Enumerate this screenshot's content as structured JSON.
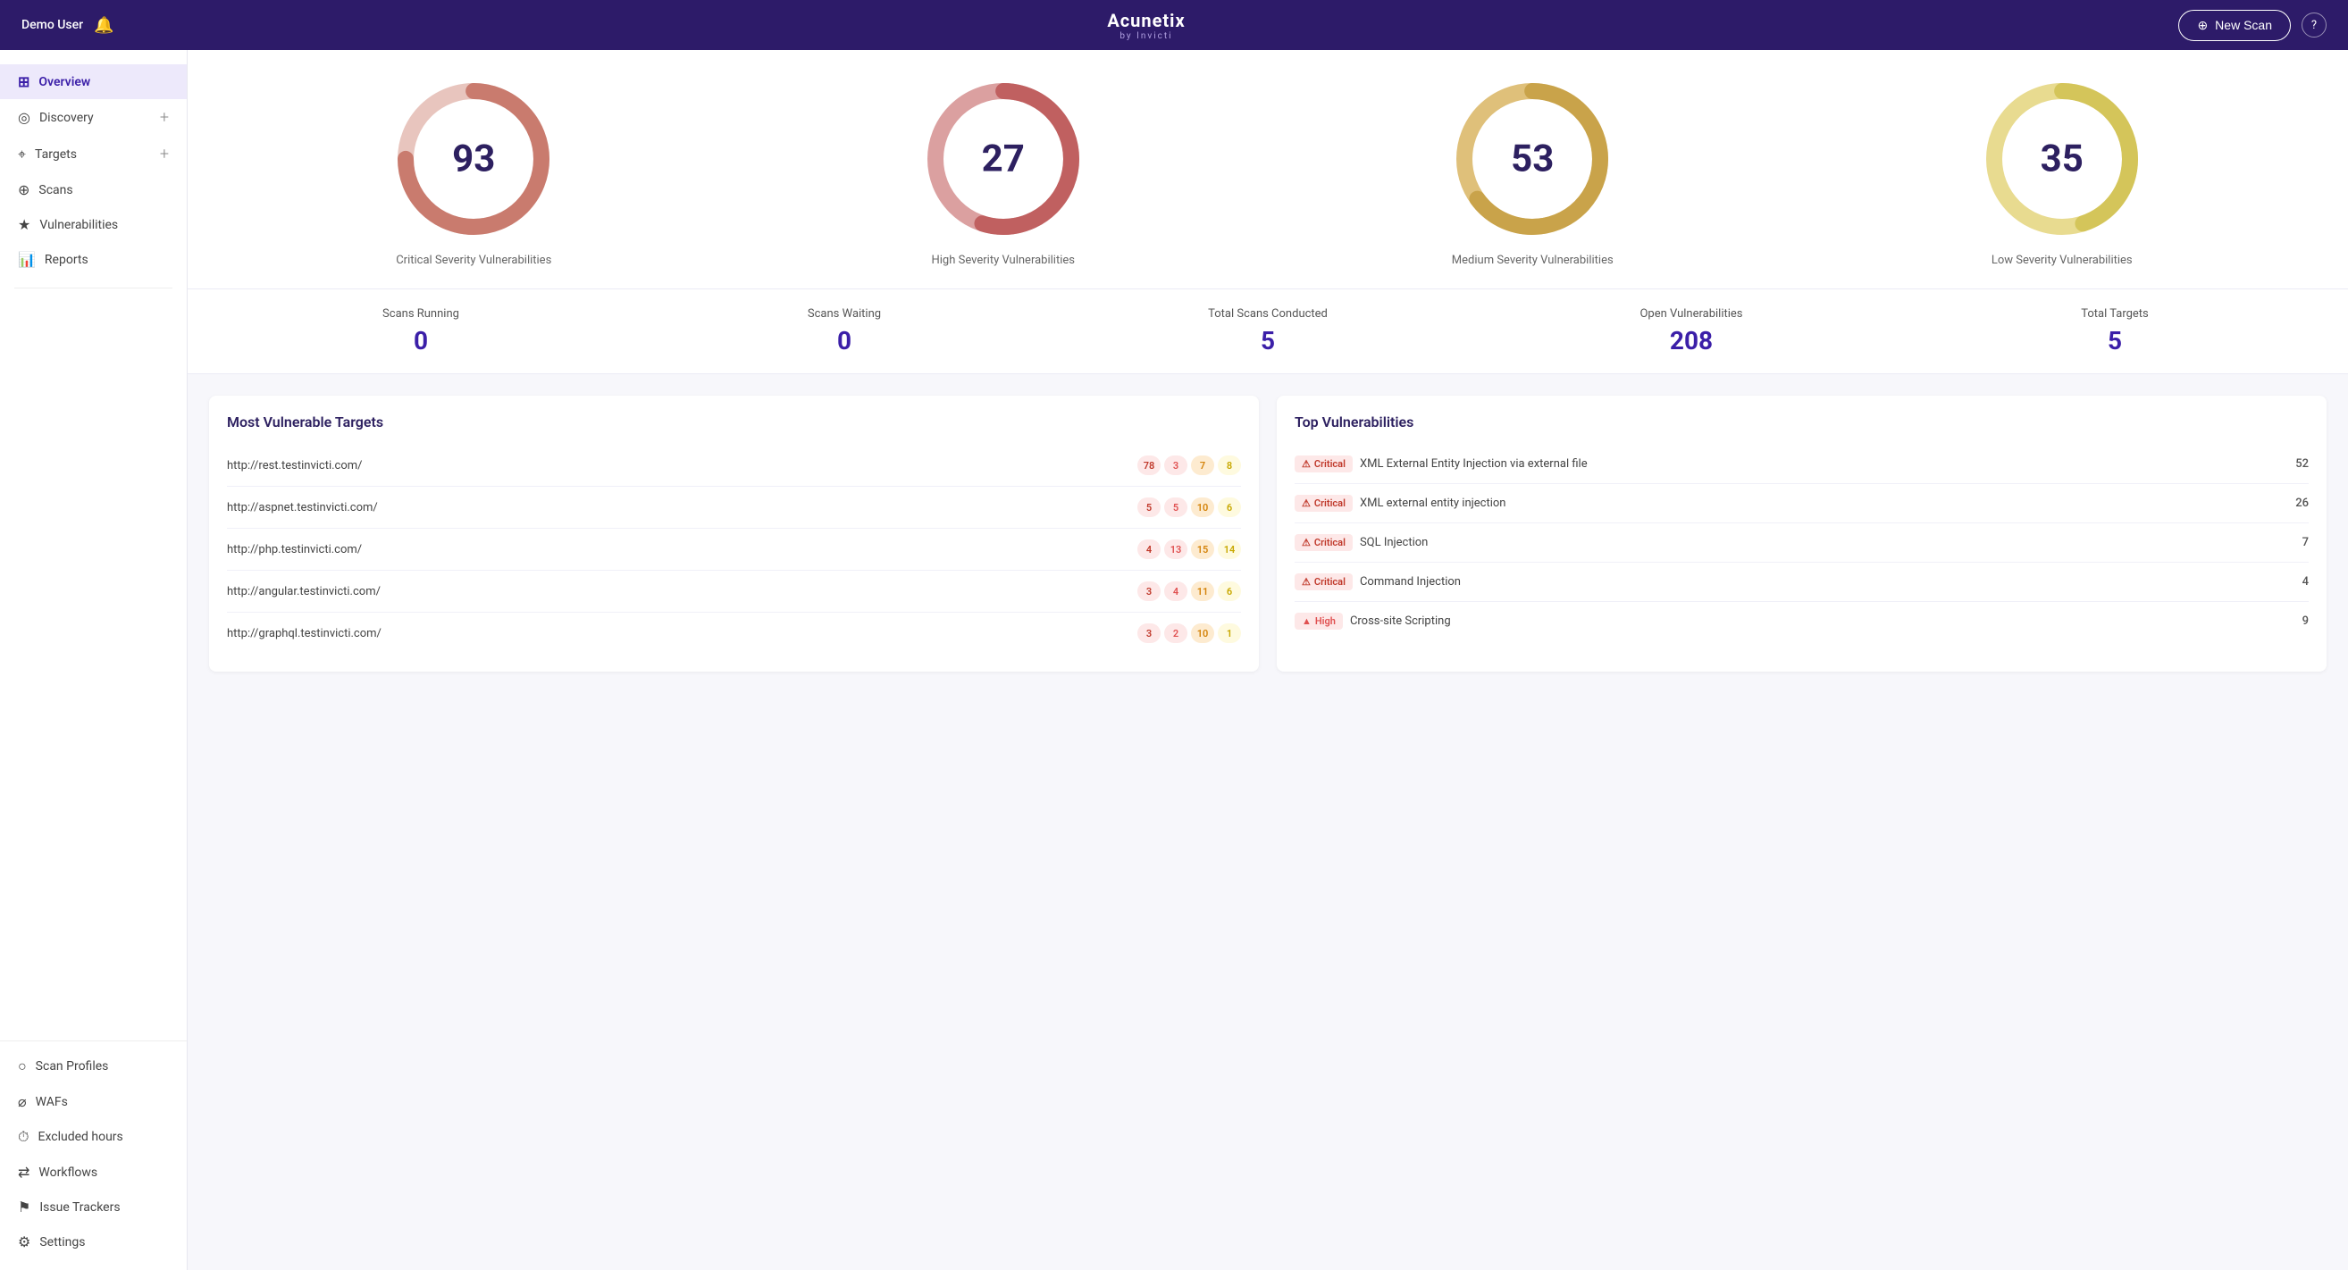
{
  "header": {
    "user": "Demo User",
    "logo": "Acunetix",
    "logo_sub": "by Invicti",
    "new_scan_label": "New Scan",
    "help_icon": "?"
  },
  "sidebar": {
    "main_items": [
      {
        "id": "overview",
        "label": "Overview",
        "icon": "⊞",
        "active": true,
        "has_add": false
      },
      {
        "id": "discovery",
        "label": "Discovery",
        "icon": "◎",
        "active": false,
        "has_add": true
      },
      {
        "id": "targets",
        "label": "Targets",
        "icon": "⌖",
        "active": false,
        "has_add": true
      },
      {
        "id": "scans",
        "label": "Scans",
        "icon": "⊕",
        "active": false,
        "has_add": false
      },
      {
        "id": "vulnerabilities",
        "label": "Vulnerabilities",
        "icon": "★",
        "active": false,
        "has_add": false
      },
      {
        "id": "reports",
        "label": "Reports",
        "icon": "📊",
        "active": false,
        "has_add": false
      }
    ],
    "bottom_items": [
      {
        "id": "scan-profiles",
        "label": "Scan Profiles",
        "icon": "○"
      },
      {
        "id": "wafs",
        "label": "WAFs",
        "icon": "⌀"
      },
      {
        "id": "excluded-hours",
        "label": "Excluded hours",
        "icon": "⏱"
      },
      {
        "id": "workflows",
        "label": "Workflows",
        "icon": "⇄"
      },
      {
        "id": "issue-trackers",
        "label": "Issue Trackers",
        "icon": "⚑"
      },
      {
        "id": "settings",
        "label": "Settings",
        "icon": "⚙"
      }
    ]
  },
  "donut_stats": [
    {
      "id": "critical",
      "value": "93",
      "label": "Critical Severity Vulnerabilities",
      "color": "#c97b6e",
      "bg": "#e8b5ae",
      "pct": 0.75
    },
    {
      "id": "high",
      "value": "27",
      "label": "High Severity Vulnerabilities",
      "color": "#c06060",
      "bg": "#d98080",
      "pct": 0.55
    },
    {
      "id": "medium",
      "value": "53",
      "label": "Medium Severity Vulnerabilities",
      "color": "#c9a34a",
      "bg": "#dfc07a",
      "pct": 0.65
    },
    {
      "id": "low",
      "value": "35",
      "label": "Low Severity Vulnerabilities",
      "color": "#d4c55a",
      "bg": "#e8db90",
      "pct": 0.45
    }
  ],
  "metrics": [
    {
      "id": "scans-running",
      "label": "Scans Running",
      "value": "0"
    },
    {
      "id": "scans-waiting",
      "label": "Scans Waiting",
      "value": "0"
    },
    {
      "id": "total-scans",
      "label": "Total Scans Conducted",
      "value": "5"
    },
    {
      "id": "open-vulns",
      "label": "Open Vulnerabilities",
      "value": "208"
    },
    {
      "id": "total-targets",
      "label": "Total Targets",
      "value": "5"
    }
  ],
  "most_vulnerable": {
    "title": "Most Vulnerable Targets",
    "targets": [
      {
        "url": "http://rest.testinvicti.com/",
        "badges": [
          {
            "type": "critical",
            "val": "78"
          },
          {
            "type": "high",
            "val": "3"
          },
          {
            "type": "medium",
            "val": "7"
          },
          {
            "type": "low",
            "val": "8"
          }
        ]
      },
      {
        "url": "http://aspnet.testinvicti.com/",
        "badges": [
          {
            "type": "critical",
            "val": "5"
          },
          {
            "type": "high",
            "val": "5"
          },
          {
            "type": "medium",
            "val": "10"
          },
          {
            "type": "low",
            "val": "6"
          }
        ]
      },
      {
        "url": "http://php.testinvicti.com/",
        "badges": [
          {
            "type": "critical",
            "val": "4"
          },
          {
            "type": "high",
            "val": "13"
          },
          {
            "type": "medium",
            "val": "15"
          },
          {
            "type": "low",
            "val": "14"
          }
        ]
      },
      {
        "url": "http://angular.testinvicti.com/",
        "badges": [
          {
            "type": "critical",
            "val": "3"
          },
          {
            "type": "high",
            "val": "4"
          },
          {
            "type": "medium",
            "val": "11"
          },
          {
            "type": "low",
            "val": "6"
          }
        ]
      },
      {
        "url": "http://graphql.testinvicti.com/",
        "badges": [
          {
            "type": "critical",
            "val": "3"
          },
          {
            "type": "high",
            "val": "2"
          },
          {
            "type": "medium",
            "val": "10"
          },
          {
            "type": "low",
            "val": "1"
          }
        ]
      }
    ]
  },
  "top_vulnerabilities": {
    "title": "Top Vulnerabilities",
    "items": [
      {
        "severity": "Critical",
        "name": "XML External Entity Injection via external file",
        "count": "52"
      },
      {
        "severity": "Critical",
        "name": "XML external entity injection",
        "count": "26"
      },
      {
        "severity": "Critical",
        "name": "SQL Injection",
        "count": "7"
      },
      {
        "severity": "Critical",
        "name": "Command Injection",
        "count": "4"
      },
      {
        "severity": "High",
        "name": "Cross-site Scripting",
        "count": "9"
      }
    ]
  }
}
